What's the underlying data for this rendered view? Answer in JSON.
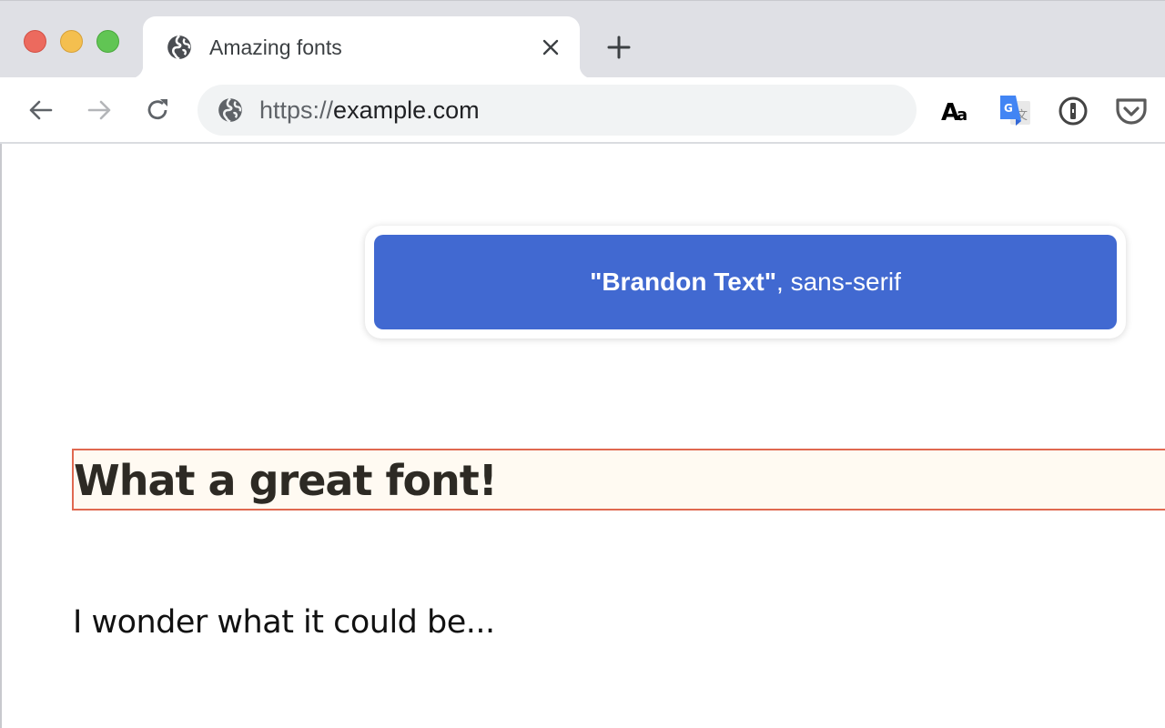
{
  "window": {
    "controls": [
      "close",
      "minimize",
      "zoom"
    ]
  },
  "tab": {
    "title": "Amazing fonts",
    "favicon": "globe-icon",
    "close_icon": "close-icon"
  },
  "new_tab": {
    "icon": "plus-icon"
  },
  "toolbar": {
    "back_icon": "arrow-left-icon",
    "forward_icon": "arrow-right-icon",
    "reload_icon": "reload-icon",
    "url_scheme": "https://",
    "url_host": "example.com",
    "site_icon": "globe-icon",
    "extensions": [
      {
        "name": "fonts-extension",
        "icon": "font-aa-icon"
      },
      {
        "name": "google-translate",
        "icon": "translate-icon"
      },
      {
        "name": "1password",
        "icon": "1password-icon"
      },
      {
        "name": "pocket",
        "icon": "pocket-icon"
      }
    ]
  },
  "font_popup": {
    "primary_font": "\"Brandon Text\"",
    "separator": ", ",
    "fallback": "sans-serif",
    "chip_color": "#4169d1"
  },
  "content": {
    "heading": "What a great font!",
    "paragraph": "I wonder what it could be...",
    "highlight_border_color": "#e06950",
    "highlight_fill_color": "#fffaf2"
  }
}
